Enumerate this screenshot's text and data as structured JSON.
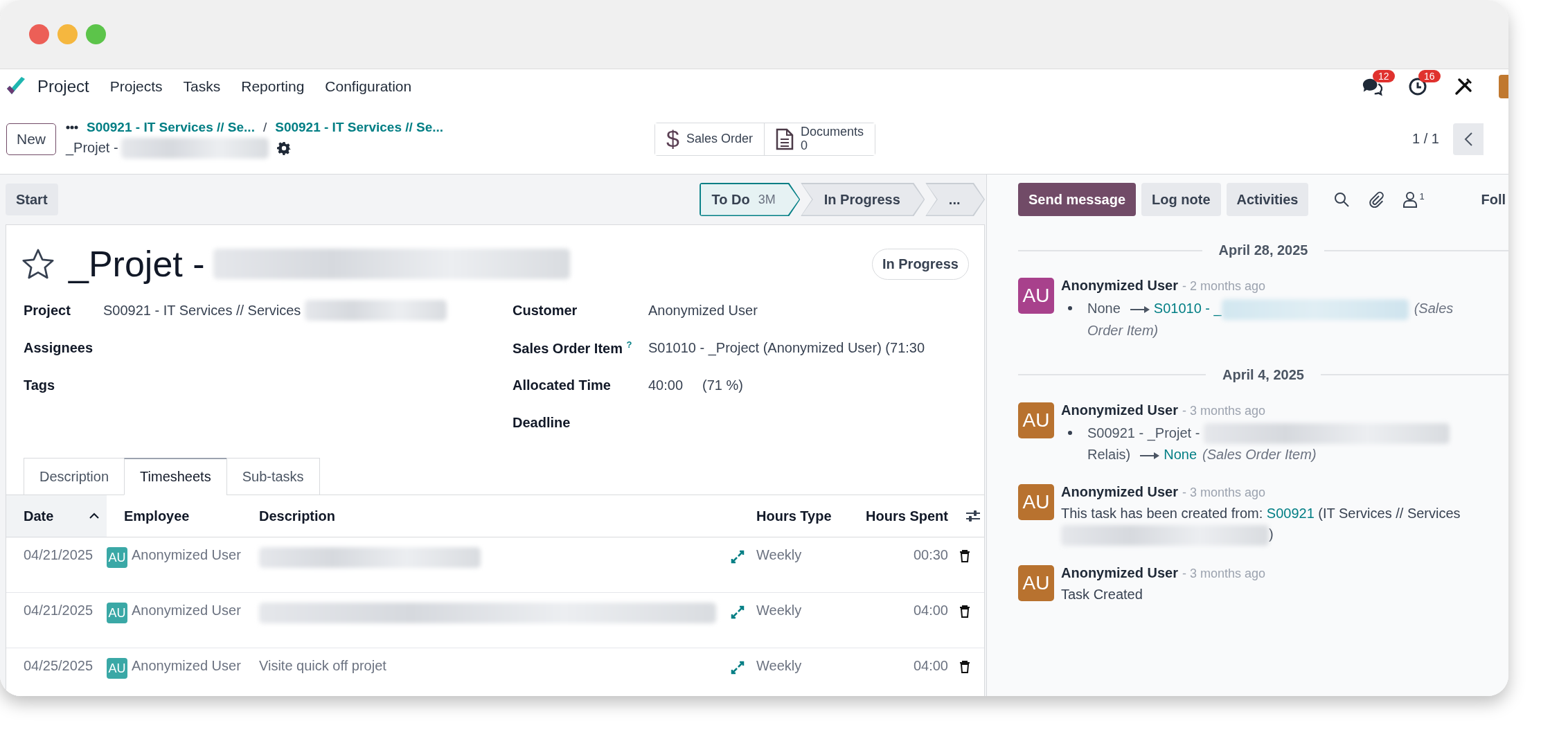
{
  "window_controls": [
    {
      "color": "#ec5f57"
    },
    {
      "color": "#f5b73f"
    },
    {
      "color": "#5cc44a"
    }
  ],
  "navbar": {
    "app": "Project",
    "menu": [
      "Projects",
      "Tasks",
      "Reporting",
      "Configuration"
    ],
    "systray": [
      {
        "kind": "chat",
        "badge": "12"
      },
      {
        "kind": "clock",
        "badge": "16"
      },
      {
        "kind": "tools"
      }
    ]
  },
  "control_panel": {
    "new_button": "New",
    "breadcrumbs": [
      "S00921 - IT Services // Se...",
      "S00921 - IT Services // Se..."
    ],
    "separator": "/",
    "record_name": "_Projet -",
    "record_redacted": true,
    "smart_buttons": [
      {
        "kind": "dollar",
        "icon": "$",
        "label": "Sales Order"
      },
      {
        "kind": "document",
        "label": "Documents",
        "count": "0"
      }
    ],
    "pager": "1 / 1"
  },
  "statusbar": {
    "start_button": "Start",
    "stages": [
      {
        "label": "To Do",
        "badge": "3M",
        "selected": true
      },
      {
        "label": "In Progress",
        "selected": false
      },
      {
        "label": "...",
        "selected": false
      }
    ]
  },
  "task": {
    "starred": false,
    "title": "_Projet -",
    "title_redacted": true,
    "stage_badge": "In Progress",
    "fields_left": [
      {
        "label": "Project",
        "value": "S00921 - IT Services // Services",
        "redacted": true
      },
      {
        "label": "Assignees"
      },
      {
        "label": "Tags"
      }
    ],
    "fields_right": [
      {
        "label": "Customer",
        "value": "Anonymized User"
      },
      {
        "label": "Sales Order Item",
        "help": "?",
        "value": "S01010 - _Project (Anonymized User) (71:30"
      },
      {
        "label": "Allocated Time",
        "value": "40:00",
        "extra": "(71 %)"
      },
      {
        "label": "Deadline"
      }
    ]
  },
  "tabs": [
    {
      "label": "Description",
      "selected": false
    },
    {
      "label": "Timesheets",
      "selected": true
    },
    {
      "label": "Sub-tasks",
      "selected": false
    }
  ],
  "timesheet": {
    "columns": [
      {
        "label": "Date",
        "sorted": true
      },
      {
        "label": "Employee",
        "sorted": false
      },
      {
        "label": "Description",
        "sorted": false
      },
      {
        "label": "Hours Type",
        "sorted": false
      },
      {
        "label": "Hours Spent",
        "sorted": false
      }
    ],
    "rows": [
      {
        "date": "04/21/2025",
        "initials": "AU",
        "color": "#3aa8a6",
        "employee": "Anonymized User",
        "description_redacted": true,
        "hours_type": "Weekly",
        "hours": "00:30"
      },
      {
        "date": "04/21/2025",
        "initials": "AU",
        "color": "#3aa8a6",
        "employee": "Anonymized User",
        "description_redacted": true,
        "hours_type": "Weekly",
        "hours": "04:00"
      },
      {
        "date": "04/25/2025",
        "initials": "AU",
        "color": "#3aa8a6",
        "employee": "Anonymized User",
        "description": "Visite quick off projet",
        "description_redacted": false,
        "hours_type": "Weekly",
        "hours": "04:00"
      }
    ]
  },
  "chatter": {
    "buttons": [
      {
        "label": "Send message",
        "selected": true
      },
      {
        "label": "Log note",
        "selected": false
      },
      {
        "label": "Activities",
        "selected": false
      }
    ],
    "follower_count": "1",
    "follow_label": "Foll",
    "groups": [
      {
        "date": "April 28, 2025",
        "messages": [
          {
            "kind": "tracking",
            "initials": "AU",
            "color": "#a8418c",
            "author": "Anonymized User",
            "time": "- 2 months ago",
            "old": "None",
            "new": "S01010 - _",
            "new_link": true,
            "new_redacted": true,
            "field": "(Sales Order Item)"
          }
        ]
      },
      {
        "date": "April 4, 2025",
        "messages": [
          {
            "kind": "tracking",
            "initials": "AU",
            "color": "#b8722f",
            "author": "Anonymized User",
            "time": "- 3 months ago",
            "old": "S00921 - _Projet -",
            "old_redacted": true,
            "old_tail": "Relais)",
            "new": "None",
            "new_link": true,
            "field": "(Sales Order Item)"
          },
          {
            "kind": "text",
            "initials": "AU",
            "color": "#b8722f",
            "author": "Anonymized User",
            "time": "- 3 months ago",
            "body": "This task has been created from: ",
            "link": "S00921",
            "body_after": " (IT Services // Services",
            "redacted": true,
            "closing": ")"
          },
          {
            "kind": "text",
            "initials": "AU",
            "color": "#b8722f",
            "author": "Anonymized User",
            "time": "- 3 months ago",
            "body": "Task Created"
          }
        ]
      }
    ]
  }
}
